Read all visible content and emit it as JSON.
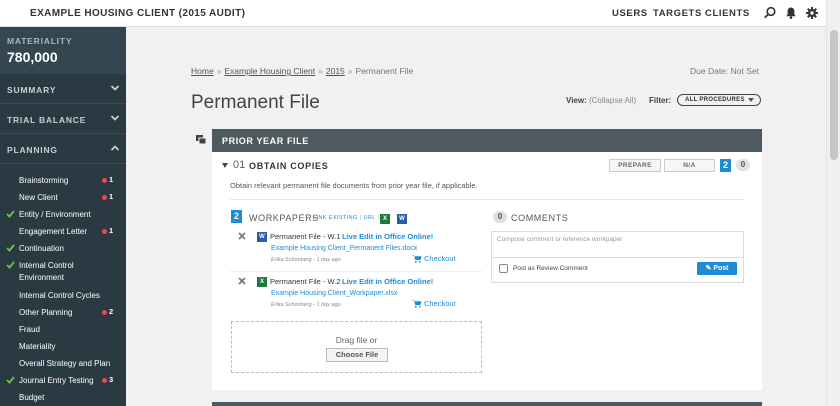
{
  "topbar": {
    "client_title": "EXAMPLE HOUSING CLIENT (2015 AUDIT)",
    "nav": [
      "USERS",
      "TARGETS",
      "CLIENTS"
    ],
    "icons": [
      "search-icon",
      "bell-icon",
      "gear-icon"
    ]
  },
  "sidebar": {
    "materiality_label": "MATERIALITY",
    "materiality_value": "780,000",
    "sections": [
      {
        "label": "SUMMARY",
        "state": "collapsed"
      },
      {
        "label": "TRIAL BALANCE",
        "state": "collapsed"
      },
      {
        "label": "PLANNING",
        "state": "expanded"
      }
    ],
    "items": [
      {
        "label": "Brainstorming",
        "checked": false,
        "count": "1"
      },
      {
        "label": "New Client",
        "checked": false,
        "count": "1"
      },
      {
        "label": "Entity / Environment",
        "checked": true,
        "count": ""
      },
      {
        "label": "Engagement Letter",
        "checked": false,
        "count": "1"
      },
      {
        "label": "Continuation",
        "checked": true,
        "count": ""
      },
      {
        "label": "Internal Control",
        "label2": "Environment",
        "checked": true,
        "count": ""
      },
      {
        "label": "Internal Control Cycles",
        "checked": false,
        "count": ""
      },
      {
        "label": "Other Planning",
        "checked": false,
        "count": "2"
      },
      {
        "label": "Fraud",
        "checked": false,
        "count": ""
      },
      {
        "label": "Materiality",
        "checked": false,
        "count": ""
      },
      {
        "label": "Overall Strategy and Plan",
        "checked": false,
        "count": ""
      },
      {
        "label": "Journal Entry Testing",
        "checked": true,
        "count": "3"
      },
      {
        "label": "Budget",
        "checked": false,
        "count": ""
      }
    ]
  },
  "breadcrumb": {
    "items": [
      "Home",
      "Example Housing Client",
      "2015"
    ],
    "current": "Permanent File",
    "separator": "»"
  },
  "due_date": "Due Date: Not Set",
  "page_title": "Permanent File",
  "view": {
    "label": "View:",
    "value": "(Collapse All)"
  },
  "filter": {
    "label": "Filter:",
    "selected": "ALL PROCEDURES"
  },
  "section": {
    "title": "PRIOR YEAR FILE"
  },
  "procedure": {
    "number": "01",
    "title": "OBTAIN COPIES",
    "prepare_label": "PREPARE",
    "na_label": "N/A",
    "workpaper_count": "2",
    "comment_count": "0",
    "description": "Obtain relevant permanent file documents from prior year file, if applicable."
  },
  "workpapers": {
    "count": "2",
    "heading": "WORKPAPERS",
    "link_existing": "LINK EXISTING",
    "url": "URL",
    "items": [
      {
        "name": "Permanent File - W.1",
        "live_edit": "Live Edit in Office Online!",
        "filename": "Example Housing Client_Permanent Files.docx",
        "meta": "Erika Schonberg - 1 day ago",
        "checkout": "Checkout",
        "type": "doc"
      },
      {
        "name": "Permanent File - W.2",
        "live_edit": "Live Edit in Office Online!",
        "filename": "Example Housing Client_Workpaper.xlsx",
        "meta": "Erika Schonberg - 1 day ago",
        "checkout": "Checkout",
        "type": "xls"
      }
    ],
    "drop_text": "Drag file or",
    "choose_file": "Choose File"
  },
  "comments": {
    "count": "0",
    "heading": "COMMENTS",
    "placeholder": "Compose comment or reference workpaper",
    "review_label": "Post as Review Comment",
    "post_label": "Post"
  },
  "colors": {
    "sidebar_bg": "#2b3a42",
    "section_header": "#4d5a60",
    "accent_blue": "#1e8bd6",
    "alert_red": "#e84c4c",
    "check_green": "#6cc24a"
  }
}
